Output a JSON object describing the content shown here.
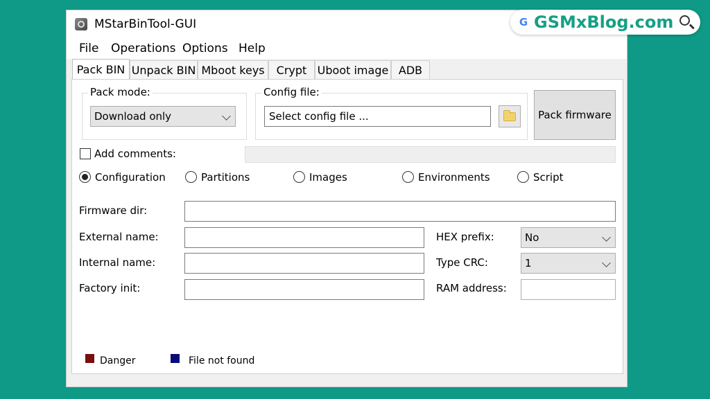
{
  "window": {
    "title": "MStarBinTool-GUI",
    "icon": "app-gear-icon"
  },
  "menu": [
    "File",
    "Operations",
    "Options",
    "Help"
  ],
  "tabs": [
    "Pack BIN",
    "Unpack BIN",
    "Mboot keys",
    "Crypt",
    "Uboot image",
    "ADB"
  ],
  "active_tab": "Pack BIN",
  "pack_mode": {
    "label": "Pack mode:",
    "value": "Download only"
  },
  "config_file": {
    "label": "Config file:",
    "value": "Select config file ..."
  },
  "pack_button": "Pack firmware",
  "add_comments": {
    "label": "Add comments:",
    "checked": false
  },
  "radios": {
    "selected": "Configuration",
    "items": [
      "Configuration",
      "Partitions",
      "Images",
      "Environments",
      "Script"
    ]
  },
  "fields": {
    "firmware_dir": {
      "label": "Firmware dir:",
      "value": ""
    },
    "external_name": {
      "label": "External name:",
      "value": ""
    },
    "internal_name": {
      "label": "Internal name:",
      "value": ""
    },
    "factory_init": {
      "label": "Factory init:",
      "value": ""
    },
    "hex_prefix": {
      "label": "HEX prefix:",
      "value": "No"
    },
    "type_crc": {
      "label": "Type CRC:",
      "value": "1"
    },
    "ram_address": {
      "label": "RAM address:",
      "value": ""
    }
  },
  "legend": [
    {
      "label": "Danger",
      "color": "#7a0f0f"
    },
    {
      "label": "File not found",
      "color": "#0a0a7a"
    }
  ],
  "badge": {
    "text": "GSMxBlog.com",
    "logo": "G",
    "brand_color": "#16a085"
  }
}
